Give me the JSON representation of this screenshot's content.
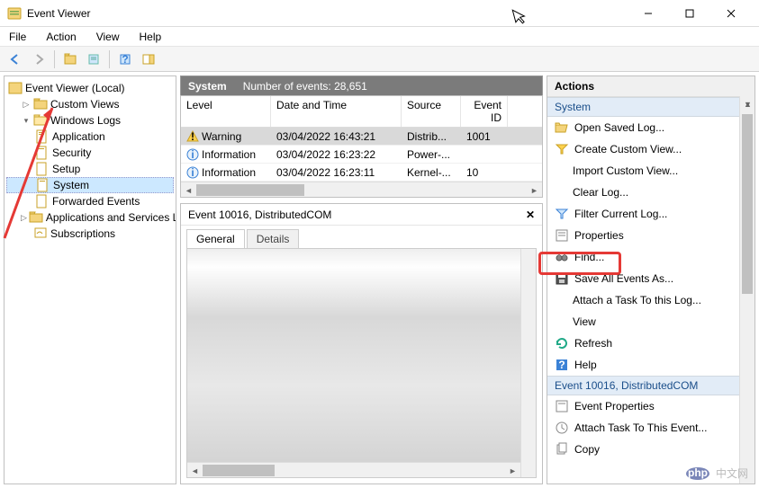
{
  "window": {
    "title": "Event Viewer"
  },
  "menu": {
    "file": "File",
    "action": "Action",
    "view": "View",
    "help": "Help"
  },
  "tree": {
    "root": "Event Viewer (Local)",
    "custom_views": "Custom Views",
    "windows_logs": "Windows Logs",
    "logs": {
      "application": "Application",
      "security": "Security",
      "setup": "Setup",
      "system": "System",
      "forwarded": "Forwarded Events"
    },
    "apps_services": "Applications and Services Lo",
    "subscriptions": "Subscriptions"
  },
  "middle": {
    "header_label": "System",
    "count_label": "Number of events: 28,651",
    "cols": {
      "level": "Level",
      "date": "Date and Time",
      "source": "Source",
      "eventid": "Event ID"
    },
    "rows": [
      {
        "level": "Warning",
        "icon": "warn",
        "date": "03/04/2022 16:43:21",
        "source": "Distrib...",
        "id": "1001"
      },
      {
        "level": "Information",
        "icon": "info",
        "date": "03/04/2022 16:23:22",
        "source": "Power-...",
        "id": ""
      },
      {
        "level": "Information",
        "icon": "info",
        "date": "03/04/2022 16:23:11",
        "source": "Kernel-...",
        "id": "10"
      }
    ],
    "preview_title": "Event 10016, DistributedCOM",
    "tabs": {
      "general": "General",
      "details": "Details"
    }
  },
  "actions": {
    "pane_title": "Actions",
    "section1": "System",
    "items1": {
      "open_saved": "Open Saved Log...",
      "create_custom": "Create Custom View...",
      "import_custom": "Import Custom View...",
      "clear_log": "Clear Log...",
      "filter": "Filter Current Log...",
      "properties": "Properties",
      "find": "Find...",
      "save_all": "Save All Events As...",
      "attach_task": "Attach a Task To this Log...",
      "view": "View",
      "refresh": "Refresh",
      "help": "Help"
    },
    "section2": "Event 10016, DistributedCOM",
    "items2": {
      "event_props": "Event Properties",
      "attach_task_event": "Attach Task To This Event...",
      "copy": "Copy"
    }
  },
  "watermark": "中文网"
}
